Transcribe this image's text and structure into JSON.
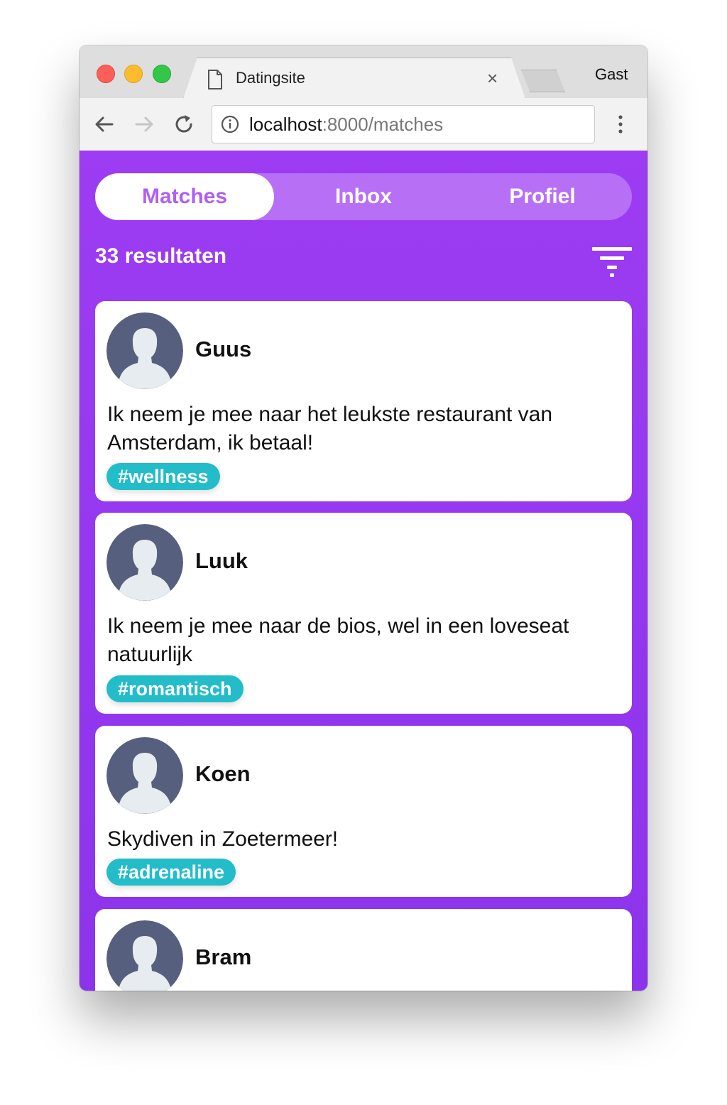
{
  "browser": {
    "tab_title": "Datingsite",
    "tab_close": "×",
    "profile": "Gast",
    "url_host": "localhost",
    "url_rest": ":8000/matches"
  },
  "nav": {
    "tabs": [
      {
        "label": "Matches",
        "active": true
      },
      {
        "label": "Inbox",
        "active": false
      },
      {
        "label": "Profiel",
        "active": false
      }
    ]
  },
  "results_label": "33 resultaten",
  "matches": [
    {
      "name": "Guus",
      "message": "Ik neem je mee naar het leukste restaurant van Amsterdam, ik betaal!",
      "tag": "#wellness"
    },
    {
      "name": "Luuk",
      "message": "Ik neem je mee naar de bios, wel in een loveseat natuurlijk",
      "tag": "#romantisch"
    },
    {
      "name": "Koen",
      "message": "Skydiven in Zoetermeer!",
      "tag": "#adrenaline"
    },
    {
      "name": "Bram"
    }
  ],
  "colors": {
    "background": "#9d3cf2",
    "tab_active_text": "#b15ff4",
    "tag": "#23bcc9",
    "avatar": "#56607e"
  },
  "icons": [
    "page-icon",
    "back-arrow-icon",
    "forward-arrow-icon",
    "reload-icon",
    "info-icon",
    "menu-dots-icon",
    "filter-icon",
    "avatar-icon"
  ]
}
